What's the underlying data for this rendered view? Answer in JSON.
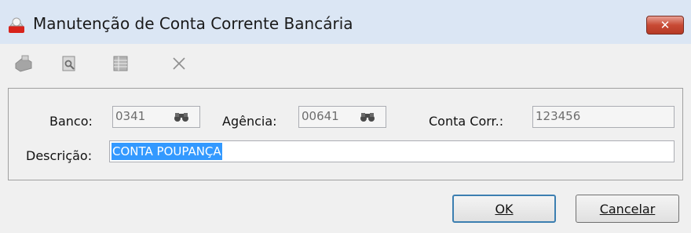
{
  "window": {
    "title": "Manutenção de Conta Corrente Bancária",
    "close_label": "✕"
  },
  "toolbar": {
    "items": [
      {
        "icon": "print-icon",
        "enabled": false
      },
      {
        "icon": "preview-icon",
        "enabled": false
      },
      {
        "icon": "grid-icon",
        "enabled": false
      },
      {
        "icon": "delete-icon",
        "enabled": false
      }
    ]
  },
  "form": {
    "banco_label": "Banco:",
    "banco_value": "0341",
    "agencia_label": "Agência:",
    "agencia_value": "00641",
    "conta_label": "Conta Corr.:",
    "conta_value": "123456",
    "descricao_label": "Descrição:",
    "descricao_value": "CONTA POUPANÇA"
  },
  "buttons": {
    "ok": "OK",
    "cancel": "Cancelar"
  },
  "colors": {
    "selection": "#3399ff",
    "close": "#c84a35",
    "window_frame": "#dbe6f4"
  }
}
